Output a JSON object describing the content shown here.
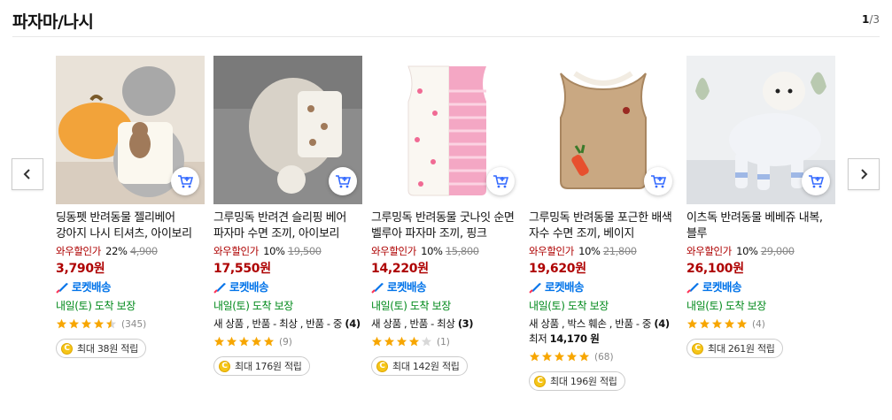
{
  "section": {
    "title": "파자마/나시",
    "pager_current": "1",
    "pager_total": "/3"
  },
  "colors": {
    "wow_red": "#ae0000",
    "rocket_blue": "#0073e9",
    "delivery_green": "#00891a",
    "star": "#f7a600"
  },
  "icons": {
    "prev": "chevron-left-icon",
    "next": "chevron-right-icon",
    "cart": "add-to-cart-icon",
    "rocket": "rocket-icon",
    "star": "star-icon",
    "coin": "coin-icon"
  },
  "products": [
    {
      "name": "딩동펫 반려동물 젤리베어 강아지 나시 티셔츠, 아이보리",
      "wow_label": "와우할인가",
      "discount": "22%",
      "original_price": "4,900",
      "price": "3,790원",
      "rocket_label": "로켓배송",
      "delivery": "내일(토) 도착 보장",
      "used_text": "",
      "used_price": "",
      "rating": 4.5,
      "review_count": "(345)",
      "reward": "최대 38원 적립",
      "coin_symbol": "C"
    },
    {
      "name": "그루밍독 반려견 슬리핑 베어 파자마 수면 조끼, 아이보리",
      "wow_label": "와우할인가",
      "discount": "10%",
      "original_price": "19,500",
      "price": "17,550원",
      "rocket_label": "로켓배송",
      "delivery": "내일(토) 도착 보장",
      "used_text": "새 상품 , 반품 - 최상 , 반품 - 중",
      "used_count": "(4)",
      "used_price": "",
      "rating": 5,
      "review_count": "(9)",
      "reward": "최대 176원 적립",
      "coin_symbol": "C"
    },
    {
      "name": "그루밍독 반려동물 굿나잇 순면 벨루아 파자마 조끼, 핑크",
      "wow_label": "와우할인가",
      "discount": "10%",
      "original_price": "15,800",
      "price": "14,220원",
      "rocket_label": "로켓배송",
      "delivery": "내일(토) 도착 보장",
      "used_text": "새 상품 , 반품 - 최상",
      "used_count": "(3)",
      "used_price": "",
      "rating": 4,
      "review_count": "(1)",
      "reward": "최대 142원 적립",
      "coin_symbol": "C"
    },
    {
      "name": "그루밍독 반려동물 포근한 배색 자수 수면 조끼, 베이지",
      "wow_label": "와우할인가",
      "discount": "10%",
      "original_price": "21,800",
      "price": "19,620원",
      "rocket_label": "로켓배송",
      "delivery": "내일(토) 도착 보장",
      "used_text": "새 상품 , 박스 훼손 , 반품 - 중",
      "used_count": "(4)",
      "used_price_label": "최저",
      "used_price": "14,170 원",
      "rating": 5,
      "review_count": "(68)",
      "reward": "최대 196원 적립",
      "coin_symbol": "C"
    },
    {
      "name": "이츠독 반려동물 베베쥬 내복, 블루",
      "wow_label": "와우할인가",
      "discount": "10%",
      "original_price": "29,000",
      "price": "26,100원",
      "rocket_label": "로켓배송",
      "delivery": "내일(토) 도착 보장",
      "used_text": "",
      "used_price": "",
      "rating": 5,
      "review_count": "(4)",
      "reward": "최대 261원 적립",
      "coin_symbol": "C"
    }
  ]
}
